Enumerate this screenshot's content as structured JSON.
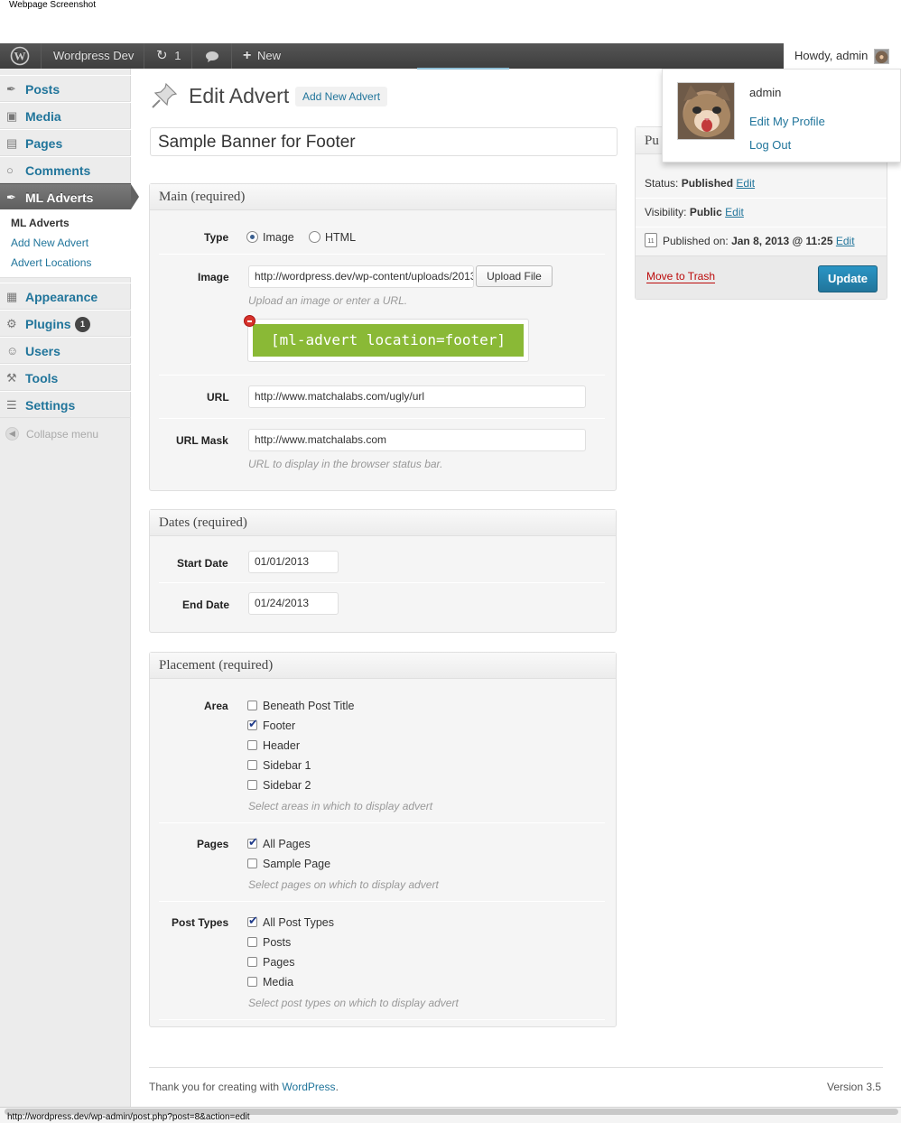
{
  "caption": "Webpage Screenshot",
  "admin_bar": {
    "site_name": "Wordpress Dev",
    "updates_count": "1",
    "new_label": "New",
    "howdy": "Howdy, admin"
  },
  "menu": {
    "items": [
      {
        "label": "Posts",
        "icon": "pin-icon"
      },
      {
        "label": "Media",
        "icon": "media-icon"
      },
      {
        "label": "Pages",
        "icon": "pages-icon"
      },
      {
        "label": "Comments",
        "icon": "comment-icon"
      },
      {
        "label": "ML Adverts",
        "icon": "pin-icon"
      },
      {
        "label": "Appearance",
        "icon": "appearance-icon"
      },
      {
        "label": "Plugins",
        "icon": "plugin-icon"
      },
      {
        "label": "Users",
        "icon": "users-icon"
      },
      {
        "label": "Tools",
        "icon": "tools-icon"
      },
      {
        "label": "Settings",
        "icon": "settings-icon"
      }
    ],
    "plugins_badge": "1",
    "submenu": [
      "ML Adverts",
      "Add New Advert",
      "Advert Locations"
    ],
    "collapse": "Collapse menu"
  },
  "header": {
    "title": "Edit Advert",
    "add_new": "Add New Advert"
  },
  "post_title": "Sample Banner for Footer",
  "main_box": {
    "title": "Main (required)",
    "type_label": "Type",
    "type_options": [
      "Image",
      "HTML"
    ],
    "type_selected": "Image",
    "image_label": "Image",
    "image_value": "http://wordpress.dev/wp-content/uploads/2013",
    "upload_button": "Upload File",
    "image_desc": "Upload an image or enter a URL.",
    "preview_text": "[ml-advert location=footer]",
    "preview_color": "#8ab936",
    "url_label": "URL",
    "url_value": "http://www.matchalabs.com/ugly/url",
    "mask_label": "URL Mask",
    "mask_value": "http://www.matchalabs.com",
    "mask_desc": "URL to display in the browser status bar."
  },
  "dates_box": {
    "title": "Dates (required)",
    "start_label": "Start Date",
    "start_value": "01/01/2013",
    "end_label": "End Date",
    "end_value": "01/24/2013"
  },
  "placement_box": {
    "title": "Placement (required)",
    "area_label": "Area",
    "areas": [
      {
        "label": "Beneath Post Title",
        "checked": false
      },
      {
        "label": "Footer",
        "checked": true
      },
      {
        "label": "Header",
        "checked": false
      },
      {
        "label": "Sidebar 1",
        "checked": false
      },
      {
        "label": "Sidebar 2",
        "checked": false
      }
    ],
    "area_desc": "Select areas in which to display advert",
    "pages_label": "Pages",
    "pages": [
      {
        "label": "All Pages",
        "checked": true
      },
      {
        "label": "Sample Page",
        "checked": false
      }
    ],
    "pages_desc": "Select pages on which to display advert",
    "post_types_label": "Post Types",
    "post_types": [
      {
        "label": "All Post Types",
        "checked": true
      },
      {
        "label": "Posts",
        "checked": false
      },
      {
        "label": "Pages",
        "checked": false
      },
      {
        "label": "Media",
        "checked": false
      }
    ],
    "post_types_desc": "Select post types on which to display advert"
  },
  "publish": {
    "title_fragment": "Pu",
    "status_label": "Status:",
    "status_value": "Published",
    "visibility_label": "Visibility:",
    "visibility_value": "Public",
    "published_label": "Published on:",
    "published_value": "Jan 8, 2013 @ 11:25",
    "edit": "Edit",
    "trash": "Move to Trash",
    "update": "Update"
  },
  "profile": {
    "name": "admin",
    "edit_profile": "Edit My Profile",
    "logout": "Log Out"
  },
  "footer": {
    "thanks": "Thank you for creating with",
    "wp_link": "WordPress",
    "period": ".",
    "version": "Version 3.5"
  },
  "status_url": "http://wordpress.dev/wp-admin/post.php?post=8&action=edit",
  "colors": {
    "link": "#21759b",
    "update_button": "#21759b",
    "trash": "#bc0b0b",
    "admin_bar": "#464646"
  }
}
